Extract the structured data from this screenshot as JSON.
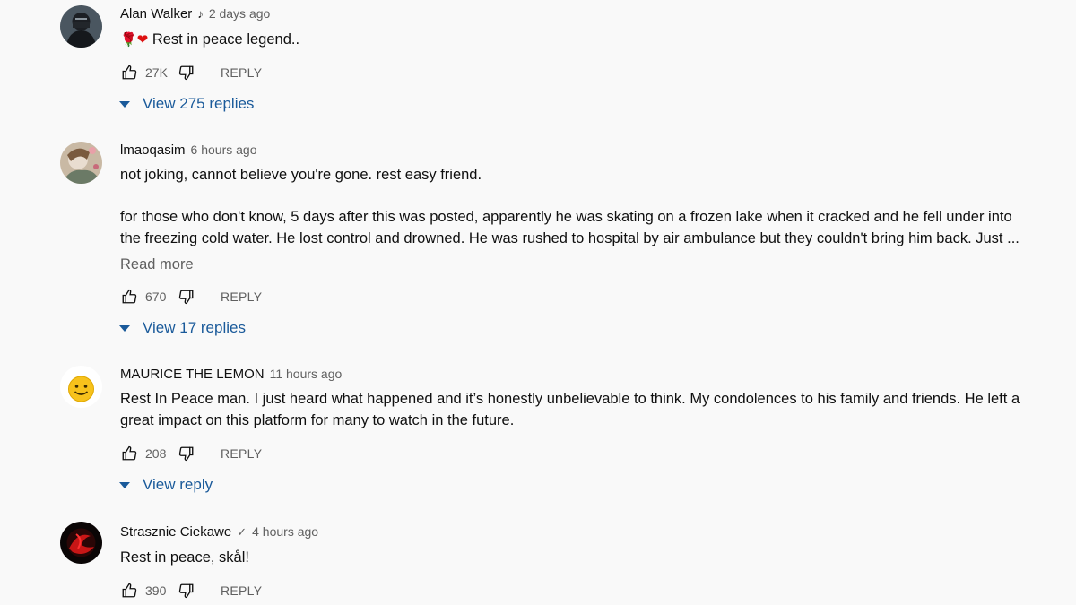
{
  "comments": [
    {
      "author": "Alan Walker",
      "badge": "♪",
      "time": "2 days ago",
      "emoji": "🌹❤",
      "text": "Rest in peace legend..",
      "likes": "27K",
      "reply_label": "REPLY",
      "replies_label": "View 275 replies"
    },
    {
      "author": "lmaoqasim",
      "time": "6 hours ago",
      "text_p1": "not joking, cannot believe you're gone. rest easy friend.",
      "text_p2_l1": "for those who don't know, 5 days after this was posted, apparently he was skating on a frozen lake when it cracked and he fell under into",
      "text_p2_l2": "the freezing cold water. He lost control and drowned. He was rushed to hospital by air ambulance but they couldn't bring him back. Just ...",
      "read_more": "Read more",
      "likes": "670",
      "reply_label": "REPLY",
      "replies_label": "View 17 replies"
    },
    {
      "author": "MAURICE THE LEMON",
      "time": "11 hours ago",
      "text_l1": "Rest In Peace man. I just heard what happened and it’s honestly unbelievable to think. My condolences to his family and friends. He left a",
      "text_l2": "great impact on this platform for many to watch in the future.",
      "likes": "208",
      "reply_label": "REPLY",
      "replies_label": "View reply"
    },
    {
      "author": "Strasznie Ciekawe",
      "badge": "✓",
      "time": "4 hours ago",
      "text": "Rest in peace, skål!",
      "likes": "390",
      "reply_label": "REPLY"
    }
  ],
  "icons": {
    "like": "thumbs-up-icon",
    "dislike": "thumbs-down-icon",
    "caret": "caret-down-icon"
  },
  "colors": {
    "background": "#f9f9f9",
    "text": "#0f0f0f",
    "secondary": "#606060",
    "link": "#1a5a9a"
  }
}
